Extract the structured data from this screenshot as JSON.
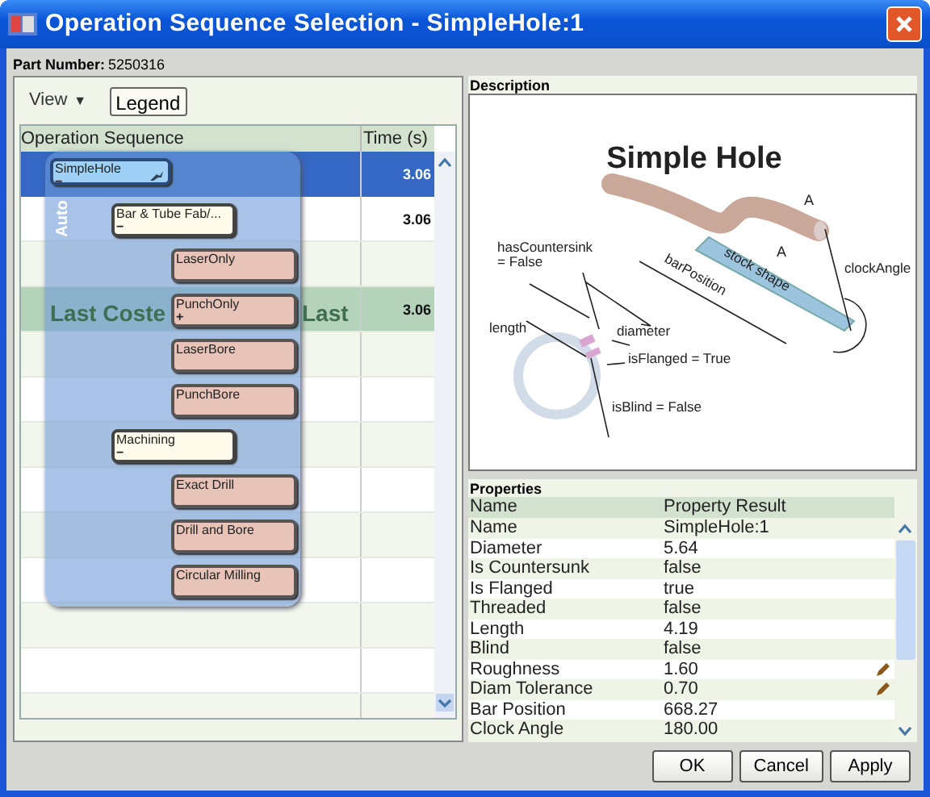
{
  "window": {
    "title": "Operation Sequence Selection - SimpleHole:1"
  },
  "part_number": {
    "label": "Part Number:",
    "value": "5250316"
  },
  "toolbar": {
    "view_menu": "View",
    "caret": "▼",
    "legend_button": "Legend"
  },
  "sequence_grid": {
    "columns": [
      "Operation Sequence",
      "Time (s)"
    ],
    "group_label": "Auto",
    "rows": [
      {
        "time": "3.06",
        "selected": true,
        "last_costed": false
      },
      {
        "time": "3.06",
        "selected": false,
        "last_costed": false
      },
      {
        "selected": false,
        "last_costed": false
      },
      {
        "time": "3.06",
        "selected": false,
        "last_costed": true,
        "banner": [
          "Last Coste",
          "Last"
        ]
      },
      {
        "selected": false,
        "last_costed": false
      },
      {
        "selected": false,
        "last_costed": false
      },
      {
        "selected": false,
        "last_costed": false
      },
      {
        "selected": false,
        "last_costed": false
      },
      {
        "selected": false,
        "last_costed": false
      },
      {
        "selected": false,
        "last_costed": false
      },
      {
        "selected": false,
        "last_costed": false
      },
      {
        "selected": false,
        "last_costed": false
      },
      {
        "selected": false,
        "last_costed": false
      }
    ],
    "tree": [
      {
        "kind": "part",
        "label": "SimpleHole",
        "sign": "−",
        "children": [
          {
            "kind": "process",
            "label": "Bar & Tube Fab/...",
            "sign": "−",
            "children": [
              {
                "kind": "operation",
                "label": "LaserOnly"
              },
              {
                "kind": "operation",
                "label": "PunchOnly",
                "sign": "+"
              },
              {
                "kind": "operation",
                "label": "LaserBore"
              },
              {
                "kind": "operation",
                "label": "PunchBore"
              }
            ]
          },
          {
            "kind": "process",
            "label": "Machining",
            "sign": "−",
            "children": [
              {
                "kind": "operation",
                "label": "Exact Drill"
              },
              {
                "kind": "operation",
                "label": "Drill and Bore"
              },
              {
                "kind": "operation",
                "label": "Circular Milling"
              }
            ]
          }
        ]
      }
    ]
  },
  "description": {
    "heading": "Description",
    "title": "Simple Hole",
    "labels": [
      "hasCountersink",
      "= False",
      "barPosition",
      "stock shape",
      "clockAngle",
      "A",
      "A",
      "length",
      "diameter",
      "isFlanged = True",
      "isBlind = False"
    ]
  },
  "properties": {
    "heading": "Properties",
    "columns": [
      "Name",
      "Property Result"
    ],
    "rows": [
      {
        "name": "Name",
        "value": "SimpleHole:1",
        "editable": false
      },
      {
        "name": "Diameter",
        "value": "5.64",
        "editable": false
      },
      {
        "name": "Is Countersunk",
        "value": "false",
        "editable": false
      },
      {
        "name": "Is Flanged",
        "value": "true",
        "editable": false
      },
      {
        "name": "Threaded",
        "value": "false",
        "editable": false
      },
      {
        "name": "Length",
        "value": "4.19",
        "editable": false
      },
      {
        "name": "Blind",
        "value": "false",
        "editable": false
      },
      {
        "name": "Roughness",
        "value": "1.60",
        "editable": true
      },
      {
        "name": "Diam Tolerance",
        "value": "0.70",
        "editable": true
      },
      {
        "name": "Bar Position",
        "value": "668.27",
        "editable": false
      },
      {
        "name": "Clock Angle",
        "value": "180.00",
        "editable": false
      }
    ]
  },
  "buttons": [
    "OK",
    "Cancel",
    "Apply"
  ]
}
